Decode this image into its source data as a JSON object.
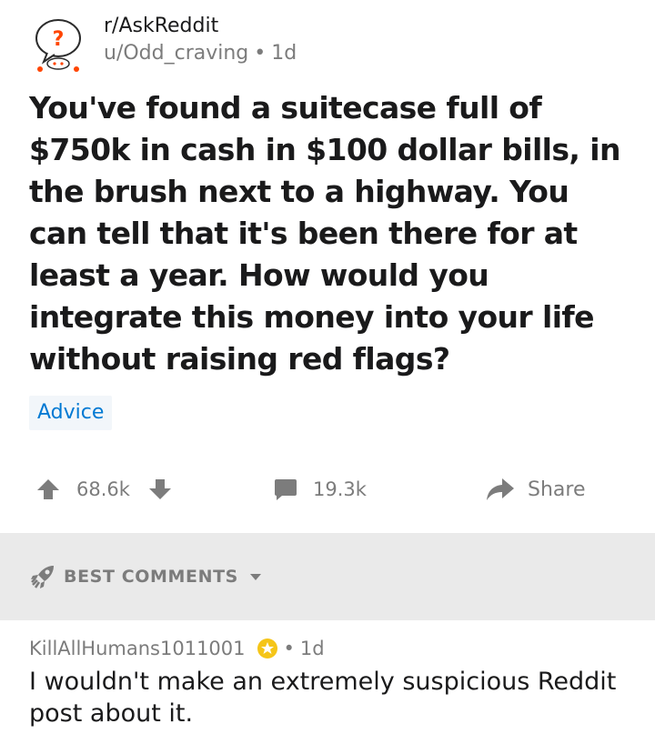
{
  "post": {
    "subreddit": "r/AskReddit",
    "author": "u/Odd_craving",
    "separator": "•",
    "age": "1d",
    "title": "You've found a suitecase full of $750k in cash in $100 dollar bills, in the brush next to a highway. You can tell that it's been there for at least a year. How would you integrate this money into your life without raising red flags?",
    "flair": "Advice",
    "upvotes": "68.6k",
    "comments": "19.3k",
    "share_label": "Share"
  },
  "sort": {
    "label": "BEST COMMENTS"
  },
  "comment": {
    "author": "KillAllHumans1011001",
    "separator": "•",
    "age": "1d",
    "body": "I wouldn't make an extremely suspicious Reddit post about it."
  },
  "icons": {
    "avatar": "subreddit-icon",
    "upvote": "upvote-arrow-icon",
    "downvote": "downvote-arrow-icon",
    "comment": "comment-bubble-icon",
    "share": "share-arrow-icon",
    "sort": "rocket-icon",
    "caret": "chevron-down-icon",
    "award": "award-icon"
  },
  "colors": {
    "flair_text": "#0079d3",
    "flair_bg": "#f2f6fa",
    "muted": "#7c7c7c",
    "sort_bar_bg": "#eaeaea",
    "award": "#f5c518"
  }
}
